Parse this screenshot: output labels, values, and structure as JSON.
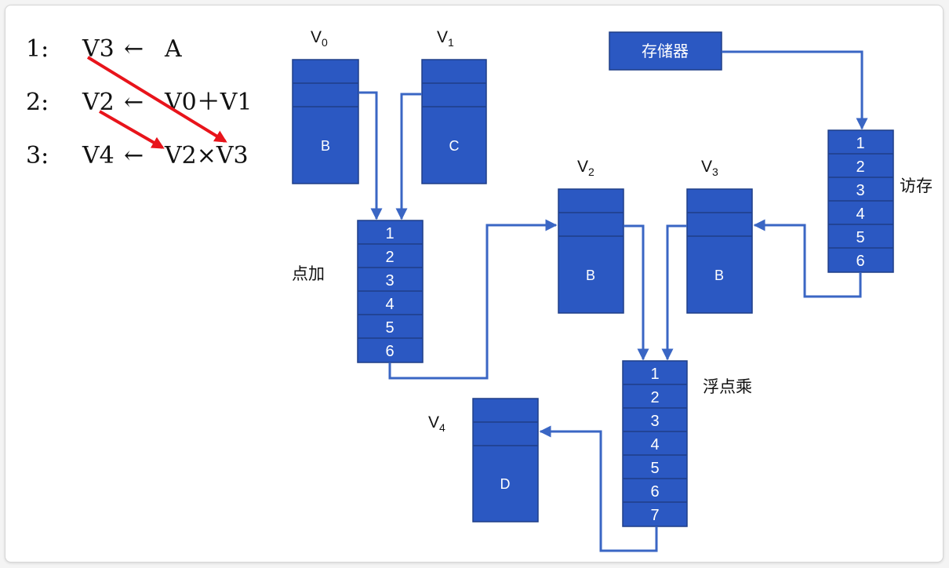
{
  "equations": [
    {
      "num": "1:",
      "lhs": "V3",
      "arrow": "←",
      "rhs": "A"
    },
    {
      "num": "2:",
      "lhs": "V2",
      "arrow": "←",
      "rhs": "V0＋V1"
    },
    {
      "num": "3:",
      "lhs": "V4",
      "arrow": "←",
      "rhs": "V2×V3"
    }
  ],
  "registers": {
    "v0": {
      "name": "V",
      "sub": "0",
      "content": "B"
    },
    "v1": {
      "name": "V",
      "sub": "1",
      "content": "C"
    },
    "v2": {
      "name": "V",
      "sub": "2",
      "content": "B"
    },
    "v3": {
      "name": "V",
      "sub": "3",
      "content": "B"
    },
    "v4": {
      "name": "V",
      "sub": "4",
      "content": "D"
    }
  },
  "memory": {
    "label": "存储器"
  },
  "pipelines": {
    "add": {
      "label": "点加",
      "stages": [
        "1",
        "2",
        "3",
        "4",
        "5",
        "6"
      ]
    },
    "load": {
      "label": "访存",
      "stages": [
        "1",
        "2",
        "3",
        "4",
        "5",
        "6"
      ]
    },
    "mul": {
      "label": "浮点乘",
      "stages": [
        "1",
        "2",
        "3",
        "4",
        "5",
        "6",
        "7"
      ]
    }
  },
  "colors": {
    "box_fill": "#2B58C2",
    "box_stroke": "#1F3E87",
    "connector": "#3A66C4",
    "dependency": "#E8141B"
  }
}
